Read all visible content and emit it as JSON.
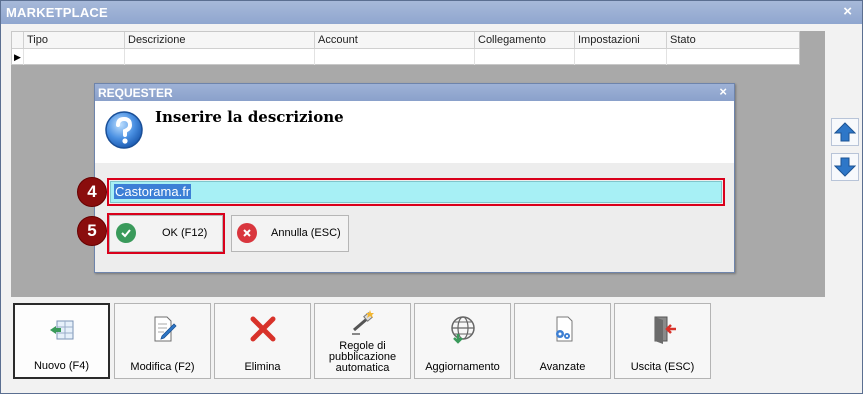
{
  "window": {
    "title": "MARKETPLACE",
    "close_glyph": "×"
  },
  "grid": {
    "columns": [
      "Tipo",
      "Descrizione",
      "Account",
      "Collegamento",
      "Impostazioni",
      "Stato"
    ],
    "row_indicator": "▶"
  },
  "side_buttons": {
    "up_icon": "arrow-up-icon",
    "down_icon": "arrow-down-icon"
  },
  "dialog": {
    "title": "REQUESTER",
    "close_glyph": "×",
    "prompt": "Inserire la descrizione",
    "input_value": "Castorama.fr",
    "ok_label": "OK (F12)",
    "cancel_label": "Annulla (ESC)"
  },
  "badges": {
    "input": "4",
    "ok": "5"
  },
  "toolbar": [
    {
      "label": "Nuovo (F4)",
      "icon": "new-icon"
    },
    {
      "label": "Modifica (F2)",
      "icon": "edit-icon"
    },
    {
      "label": "Elimina",
      "icon": "delete-icon"
    },
    {
      "label": "Regole di pubblicazione automatica",
      "icon": "magic-wand-icon"
    },
    {
      "label": "Aggiornamento",
      "icon": "globe-download-icon"
    },
    {
      "label": "Avanzate",
      "icon": "settings-document-icon"
    },
    {
      "label": "Uscita (ESC)",
      "icon": "exit-door-icon"
    }
  ],
  "colors": {
    "title_bar": "#8fa6cf",
    "input_bg": "#a7f0f5",
    "highlight": "#d9001b",
    "badge": "#8a0d0d",
    "ok_green": "#3a9a5b",
    "cancel_red": "#d9363e"
  }
}
